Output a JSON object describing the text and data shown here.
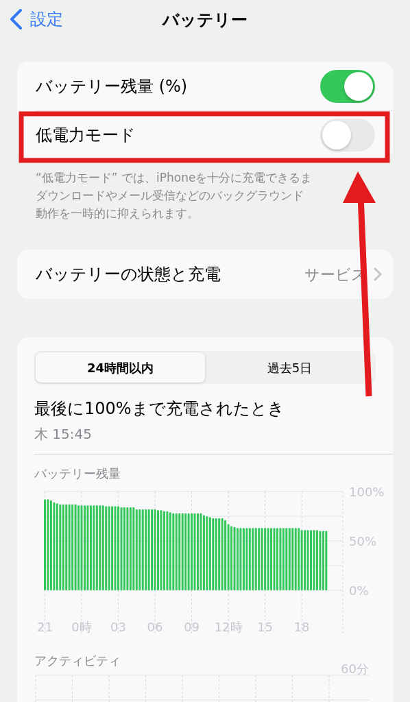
{
  "nav": {
    "back_label": "設定",
    "title": "バッテリー"
  },
  "toggles": [
    {
      "label": "バッテリー残量 (%)",
      "on": true
    },
    {
      "label": "低電力モード",
      "on": false
    }
  ],
  "footer_lines": [
    "“低電力モード” では、iPhoneを十分に充電できるま",
    "ダウンロードやメール受信などのバックグラウンド",
    "動作を一時的に抑えられます。"
  ],
  "health_row": {
    "label": "バッテリーの状態と充電",
    "value": "サービス"
  },
  "segments": [
    {
      "label": "24時間以内",
      "selected": true
    },
    {
      "label": "過去5日",
      "selected": false
    }
  ],
  "last_charge": {
    "title": "最後に100%まで充電されたとき",
    "time": "木 15:45"
  },
  "battery_chart": {
    "chart_data": {
      "type": "bar",
      "title": "バッテリー残量",
      "grid": true,
      "ylim": [
        0,
        100
      ],
      "yticks": [
        {
          "value": 0,
          "label": "0%"
        },
        {
          "value": 50,
          "label": "50%"
        },
        {
          "value": 100,
          "label": "100%"
        }
      ],
      "categories": [
        "21",
        null,
        null,
        null,
        null,
        null,
        null,
        null,
        null,
        null,
        null,
        null,
        "0時",
        null,
        null,
        null,
        null,
        null,
        null,
        null,
        null,
        null,
        null,
        null,
        "03",
        null,
        null,
        null,
        null,
        null,
        null,
        null,
        null,
        null,
        null,
        null,
        "06",
        null,
        null,
        null,
        null,
        null,
        null,
        null,
        null,
        null,
        null,
        null,
        "09",
        null,
        null,
        null,
        null,
        null,
        null,
        null,
        null,
        null,
        null,
        null,
        "12時",
        null,
        null,
        null,
        null,
        null,
        null,
        null,
        null,
        null,
        null,
        null,
        "15",
        null,
        null,
        null,
        null,
        null,
        null,
        null,
        null,
        null,
        null,
        null,
        "18",
        null,
        null,
        null,
        null,
        null,
        null,
        null,
        null
      ],
      "values": [
        92,
        92,
        91,
        89,
        88,
        87,
        87,
        87,
        87,
        87,
        87,
        86,
        86,
        86,
        86,
        86,
        86,
        86,
        86,
        86,
        85,
        85,
        85,
        85,
        85,
        84,
        84,
        84,
        84,
        84,
        82,
        82,
        82,
        82,
        82,
        82,
        82,
        81,
        81,
        80,
        80,
        79,
        78,
        78,
        78,
        78,
        78,
        78,
        78,
        78,
        78,
        78,
        76,
        75,
        74,
        73,
        73,
        73,
        73,
        71,
        67,
        65,
        64,
        63,
        63,
        63,
        63,
        63,
        63,
        63,
        63,
        63,
        63,
        63,
        63,
        63,
        63,
        63,
        63,
        63,
        63,
        63,
        63,
        63,
        61,
        61,
        61,
        61,
        61,
        61,
        60,
        60,
        60
      ]
    }
  },
  "activity_chart": {
    "label": "アクティビティ",
    "y_tick": "60分"
  }
}
